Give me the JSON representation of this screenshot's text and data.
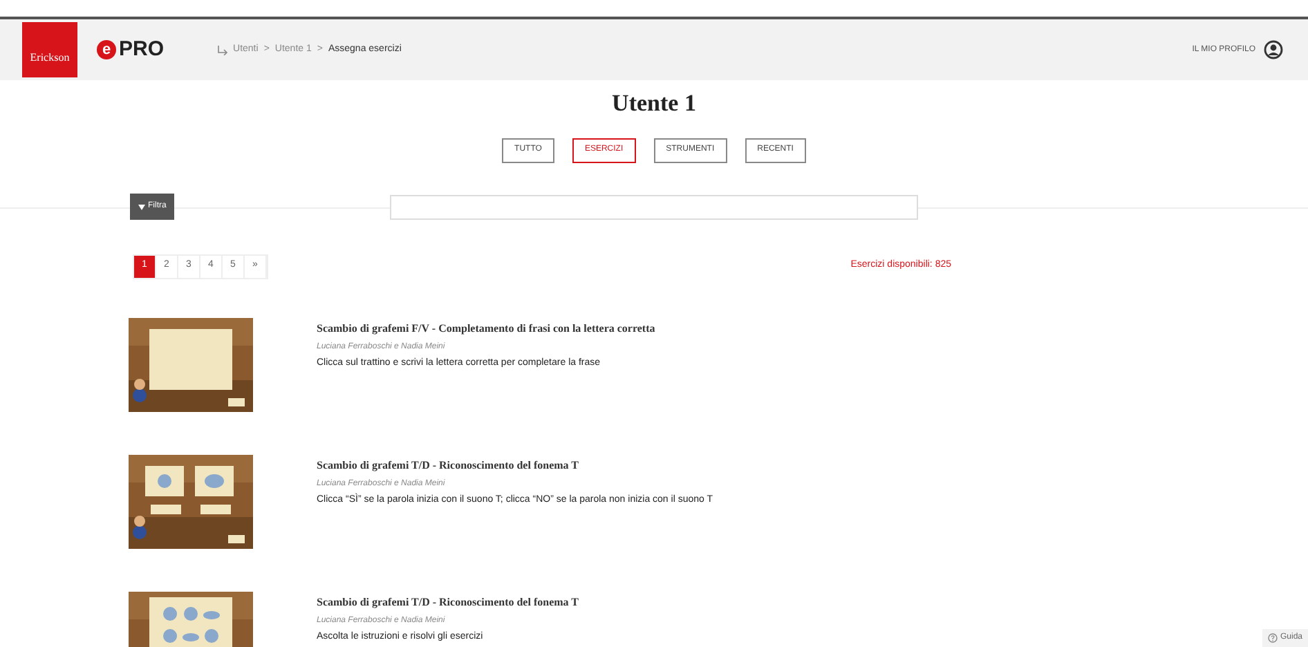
{
  "header": {
    "logo": "Erickson",
    "brand_mark": "e",
    "brand_name": "PRO",
    "breadcrumb": [
      {
        "label": "Utenti",
        "current": false
      },
      {
        "label": "Utente 1",
        "current": false
      },
      {
        "label": "Assegna esercizi",
        "current": true
      }
    ],
    "separator": ">",
    "profile": "IL MIO PROFILO"
  },
  "title": "Utente 1",
  "tabs": [
    {
      "label": "TUTTO",
      "selected": false
    },
    {
      "label": "ESERCIZI",
      "selected": true
    },
    {
      "label": "STRUMENTI",
      "selected": false
    },
    {
      "label": "RECENTI",
      "selected": false
    }
  ],
  "filter_button": "Filtra",
  "pagination": [
    {
      "label": "1",
      "selected": true
    },
    {
      "label": "2",
      "selected": false
    },
    {
      "label": "3",
      "selected": false
    },
    {
      "label": "4",
      "selected": false
    },
    {
      "label": "5",
      "selected": false
    },
    {
      "label": "»",
      "selected": false
    }
  ],
  "available": "Esercizi disponibili: 825",
  "exercises": [
    {
      "kind": "picture",
      "title": "Scambio di grafemi F/V - Completamento di frasi con la lettera corretta",
      "authors": "Luciana Ferraboschi e Nadia Meini",
      "description": "Clicca sul trattino e scrivi la lettera corretta per completare la frase"
    },
    {
      "kind": "picture",
      "title": "Scambio di grafemi T/D - Riconoscimento del fonema T",
      "authors": "Luciana Ferraboschi e Nadia Meini",
      "description": "Clicca “SÌ” se la parola inizia con il suono T; clicca “NO” se la parola non inizia con il suono T"
    },
    {
      "kind": "picture",
      "title": "Scambio di grafemi T/D - Riconoscimento del fonema T",
      "authors": "Luciana Ferraboschi e Nadia Meini",
      "description": "Ascolta le istruzioni e risolvi gli esercizi"
    }
  ],
  "help_button": "Guida"
}
